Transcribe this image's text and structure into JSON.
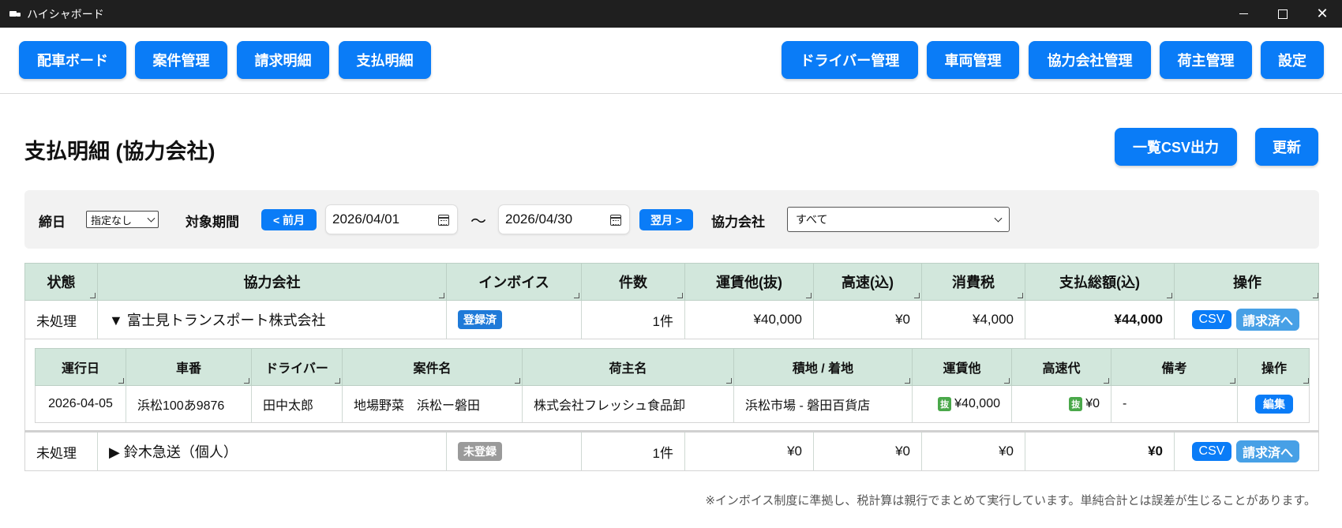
{
  "window": {
    "title": "ハイシャボード",
    "minimize": "",
    "maximize": "",
    "close": "✕"
  },
  "nav": {
    "left": [
      "配車ボード",
      "案件管理",
      "請求明細",
      "支払明細"
    ],
    "right": [
      "ドライバー管理",
      "車両管理",
      "協力会社管理",
      "荷主管理",
      "設定"
    ]
  },
  "page": {
    "title": "支払明細 (協力会社)",
    "csv_all_label": "一覧CSV出力",
    "refresh_label": "更新"
  },
  "filter": {
    "closing_label": "締日",
    "closing_value": "指定なし",
    "period_label": "対象期間",
    "prev_label": "< 前月",
    "date_from": "2026/04/01",
    "tilde": "〜",
    "date_to": "2026/04/30",
    "next_label": "翌月 >",
    "company_label": "協力会社",
    "company_value": "すべて"
  },
  "table": {
    "headers": [
      "状態",
      "協力会社",
      "インボイス",
      "件数",
      "運賃他(抜)",
      "高速(込)",
      "消費税",
      "支払総額(込)",
      "操作"
    ],
    "rows": [
      {
        "status": "未処理",
        "company": "▼ 富士見トランスポート株式会社",
        "invoice": "登録済",
        "count": "1件",
        "fare": "¥40,000",
        "highway": "¥0",
        "tax": "¥4,000",
        "total": "¥44,000",
        "csv": "CSV",
        "billed": "請求済へ"
      },
      {
        "status": "未処理",
        "company": "▶ 鈴木急送（個人）",
        "invoice": "未登録",
        "count": "1件",
        "fare": "¥0",
        "highway": "¥0",
        "tax": "¥0",
        "total": "¥0",
        "csv": "CSV",
        "billed": "請求済へ"
      }
    ]
  },
  "detail": {
    "headers": [
      "運行日",
      "車番",
      "ドライバー",
      "案件名",
      "荷主名",
      "積地 / 着地",
      "運賃他",
      "高速代",
      "備考",
      "操作"
    ],
    "row": {
      "date": "2026-04-05",
      "vehicle": "浜松100あ9876",
      "driver": "田中太郎",
      "job": "地場野菜　浜松ー磐田",
      "shipper": "株式会社フレッシュ食品卸",
      "route": "浜松市場 - 磐田百貨店",
      "tag": "抜",
      "fare": "¥40,000",
      "highway": "¥0",
      "note": "-",
      "edit": "編集"
    }
  },
  "footnote": "※インボイス制度に準拠し、税計算は親行でまとめて実行しています。単純合計とは誤差が生じることがあります。",
  "colors": {
    "primary": "#0a7cf7",
    "header_bg": "#d2e7dc",
    "registered": "#1f7ad8",
    "unregistered": "#9a9a9a",
    "tag_green": "#4aa84a",
    "billed_btn": "#47a0e6"
  }
}
